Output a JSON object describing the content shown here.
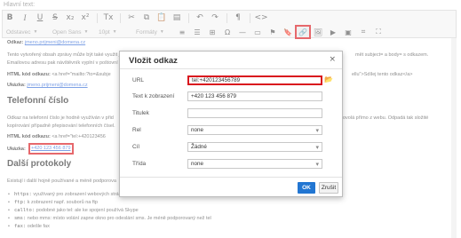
{
  "field_label": "Hlavní text:",
  "toolbar": {
    "row1": [
      {
        "name": "bold-button",
        "glyph": "B",
        "cls": "b"
      },
      {
        "name": "italic-button",
        "glyph": "I",
        "cls": "i"
      },
      {
        "name": "underline-button",
        "glyph": "U",
        "cls": "u"
      },
      {
        "name": "strikethrough-button",
        "glyph": "S",
        "cls": "s"
      },
      {
        "name": "subscript-button",
        "glyph": "x₂",
        "cls": ""
      },
      {
        "name": "superscript-button",
        "glyph": "x²",
        "cls": ""
      },
      {
        "name": "sep",
        "glyph": "",
        "cls": "sep"
      },
      {
        "name": "remove-format-button",
        "glyph": "Tx",
        "cls": ""
      },
      {
        "name": "sep",
        "glyph": "",
        "cls": "sep"
      },
      {
        "name": "cut-icon",
        "glyph": "✂",
        "cls": ""
      },
      {
        "name": "copy-icon",
        "glyph": "⧉",
        "cls": ""
      },
      {
        "name": "paste-icon",
        "glyph": "📋",
        "cls": ""
      },
      {
        "name": "paste-text-icon",
        "glyph": "▤",
        "cls": ""
      },
      {
        "name": "sep",
        "glyph": "",
        "cls": "sep"
      },
      {
        "name": "undo-icon",
        "glyph": "↶",
        "cls": ""
      },
      {
        "name": "redo-icon",
        "glyph": "↷",
        "cls": ""
      },
      {
        "name": "sep",
        "glyph": "",
        "cls": "sep"
      },
      {
        "name": "show-blocks-icon",
        "glyph": "¶",
        "cls": ""
      },
      {
        "name": "sep",
        "glyph": "",
        "cls": "sep"
      },
      {
        "name": "source-icon",
        "glyph": "<>",
        "cls": ""
      }
    ],
    "combos": {
      "style": "Odstavec",
      "font": "Open Sans",
      "size": "10pt",
      "format": "Formáty"
    },
    "row2_icons": [
      {
        "name": "list-icon",
        "glyph": "≡"
      },
      {
        "name": "align-icon",
        "glyph": "☰"
      },
      {
        "name": "table-icon",
        "glyph": "⊞"
      },
      {
        "name": "special-char-icon",
        "glyph": "Ω"
      },
      {
        "name": "hr-icon",
        "glyph": "—"
      },
      {
        "name": "iframe-icon",
        "glyph": "▭"
      },
      {
        "name": "anchor-icon",
        "glyph": "⚑"
      },
      {
        "name": "bookmark-icon",
        "glyph": "🔖"
      },
      {
        "name": "link-icon",
        "glyph": "🔗",
        "highlighted": true
      },
      {
        "name": "image-icon",
        "glyph": "🖼"
      },
      {
        "name": "media-icon",
        "glyph": "▶"
      },
      {
        "name": "box-icon",
        "glyph": "▣"
      },
      {
        "name": "code-icon",
        "glyph": "⌗"
      },
      {
        "name": "fullscreen-icon",
        "glyph": "⛶"
      }
    ]
  },
  "document": {
    "line1_prefix": "Odkaz: ",
    "line1_link": "jmeno.prijmeni@domena.cz",
    "para1a": "Tento vytvořený obsah zprávy může být také využit jako odkaz. Email bude obsahovat předmět",
    "para1a_right": "mět subject= a body= s odkazem.",
    "para1b": "Emailovou adresu pak návštěvník vyplní v poštovní aplikaci.",
    "html_code_label": "HTML kód odkazu:",
    "html_code_1": "<a href=\"mailto:?to=&subje",
    "html_code_1_right": "ellu\">Sdílej tento odkaz</a>",
    "example_label": "Ukázka:",
    "example_link": "jmeno.prijmeni@domena.cz",
    "h_phone": "Telefonní číslo",
    "para2a": "Odkaz na telefonní číslo je hodně využíván v přid",
    "para2a_right": "ovolá přímo z webu. Odpadá tak složité",
    "para2b": "kopírování případně přepisování telefonních čísel.",
    "html_code_2": "<a href=\"tel:+420123456",
    "tel_link": "+420 123 456 879",
    "h_other": "Další protokoly",
    "para3": "Existují i další hojně používané a méně podporova",
    "bullets": [
      {
        "code": "https:",
        "text": "využívaný pro zobrazení webových stránek"
      },
      {
        "code": "ftp:",
        "text": "k zobrazení např. souborů na ftp"
      },
      {
        "code": "callto:",
        "text": "podobné jako tel: ale ke spojení používá Skype"
      },
      {
        "code": "sms:",
        "text": "nebo mms: místo volání zapne okno pro odeslání sms. Je méně podporovaný než tel"
      },
      {
        "code": "fax:",
        "text": "odešle fax"
      }
    ]
  },
  "dialog": {
    "title": "Vložit odkaz",
    "close_glyph": "×",
    "fields": {
      "url_label": "URL",
      "url_value": "tel:+420123456789",
      "text_label": "Text k zobrazení",
      "text_value": "+420 123 456 879",
      "title_label": "Titulek",
      "title_value": "",
      "rel_label": "Rel",
      "rel_value": "none",
      "target_label": "Cíl",
      "target_value": "Žádné",
      "class_label": "Třída",
      "class_value": "none"
    },
    "ok_label": "OK",
    "cancel_label": "Zrušit"
  },
  "colors": {
    "highlight": "#d9171e",
    "primary_button": "#2276d2",
    "link": "#3a6fd8"
  }
}
